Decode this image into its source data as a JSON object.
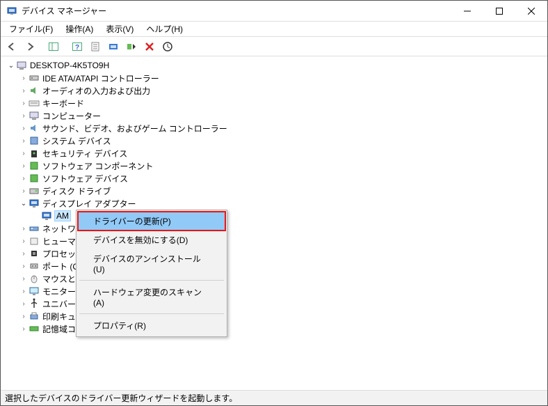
{
  "title": "デバイス マネージャー",
  "menu": {
    "file": "ファイル(F)",
    "action": "操作(A)",
    "view": "表示(V)",
    "help": "ヘルプ(H)"
  },
  "root": "DESKTOP-4K5TO9H",
  "nodes": [
    {
      "label": "IDE ATA/ATAPI コントローラー",
      "icon": "ide"
    },
    {
      "label": "オーディオの入力および出力",
      "icon": "audio"
    },
    {
      "label": "キーボード",
      "icon": "keyboard"
    },
    {
      "label": "コンピューター",
      "icon": "computer"
    },
    {
      "label": "サウンド、ビデオ、およびゲーム コントローラー",
      "icon": "sound"
    },
    {
      "label": "システム デバイス",
      "icon": "system"
    },
    {
      "label": "セキュリティ デバイス",
      "icon": "security"
    },
    {
      "label": "ソフトウェア コンポーネント",
      "icon": "software"
    },
    {
      "label": "ソフトウェア デバイス",
      "icon": "software"
    },
    {
      "label": "ディスク ドライブ",
      "icon": "disk"
    },
    {
      "label": "ディスプレイ アダプター",
      "icon": "display",
      "open": true,
      "children": [
        {
          "label": "AM",
          "icon": "display",
          "sel": true
        }
      ]
    },
    {
      "label": "ネットワー",
      "icon": "network"
    },
    {
      "label": "ヒューマン",
      "icon": "hid"
    },
    {
      "label": "プロセッ",
      "icon": "cpu"
    },
    {
      "label": "ポート (CO",
      "icon": "port"
    },
    {
      "label": "マウスと",
      "icon": "mouse"
    },
    {
      "label": "モニター",
      "icon": "monitor"
    },
    {
      "label": "ユニバーサル シリアル バス コントローラー",
      "icon": "usb"
    },
    {
      "label": "印刷キュー",
      "icon": "printer"
    },
    {
      "label": "記憶域コントローラー",
      "icon": "storage"
    }
  ],
  "ctx": {
    "update": "ドライバーの更新(P)",
    "disable": "デバイスを無効にする(D)",
    "uninstall": "デバイスのアンインストール(U)",
    "scan": "ハードウェア変更のスキャン(A)",
    "properties": "プロパティ(R)"
  },
  "status": "選択したデバイスのドライバー更新ウィザードを起動します。"
}
